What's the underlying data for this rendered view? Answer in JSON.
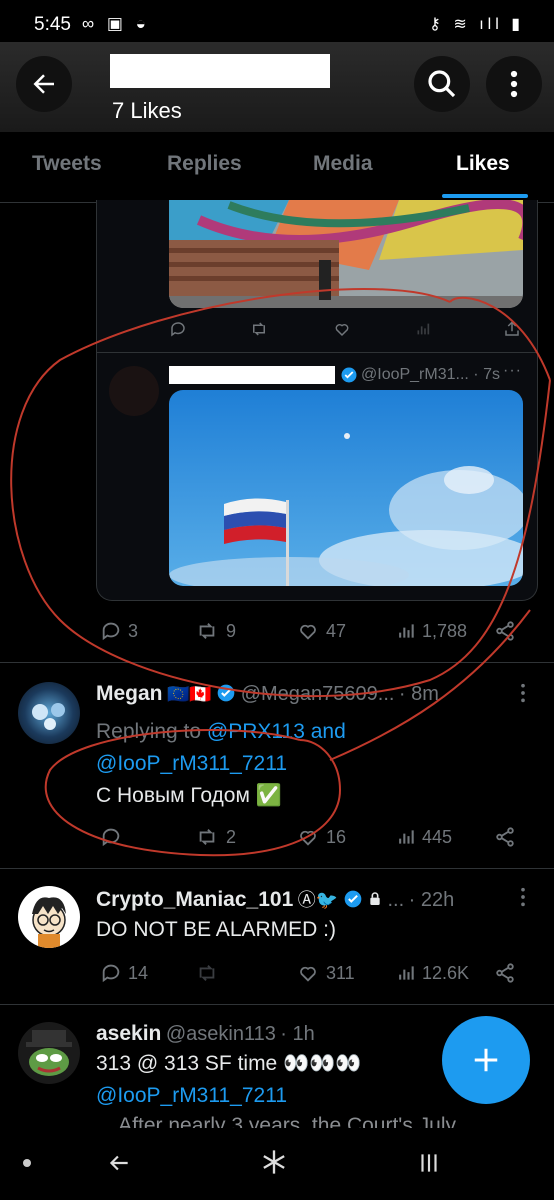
{
  "status_bar": {
    "time": "5:45",
    "left_icons": "∞ ▣ ◒",
    "right_icons": "⚷ ≋ ıll ▮"
  },
  "header": {
    "subtitle": "7 Likes"
  },
  "tabs": [
    {
      "label": "Tweets",
      "active": false
    },
    {
      "label": "Replies",
      "active": false
    },
    {
      "label": "Media",
      "active": false
    },
    {
      "label": "Likes",
      "active": true
    }
  ],
  "inner_tweet": {
    "handle_time": "@IooP_rM31... · 7s",
    "more": "···"
  },
  "tweet1_stats": {
    "replies": "3",
    "retweets": "9",
    "likes": "47",
    "views": "1,788"
  },
  "tweet2": {
    "name": "Megan",
    "flags": "🇪🇺🇨🇦",
    "handle": "@Megan75609...",
    "time": "· 8m",
    "replying_prefix": "Replying to ",
    "replying_to1": "@PRX113 and",
    "replying_to2": "@IooP_rM311_7211",
    "text": "С Новым Годом ✅",
    "stats": {
      "replies": "",
      "retweets": "2",
      "likes": "16",
      "views": "445"
    }
  },
  "tweet3": {
    "name": "Crypto_Maniac_101",
    "badges": "Ⓐ🐦",
    "handle": "...",
    "time": "· 22h",
    "text": "DO NOT BE ALARMED :)",
    "stats": {
      "replies": "14",
      "retweets": "",
      "likes": "311",
      "views": "12.6K"
    }
  },
  "tweet4": {
    "name": "asekin",
    "handle": "@asekin113",
    "time": "· 1h",
    "text_line1": "313 @ 313 SF time 👀👀👀",
    "mention": "@IooP_rM311_7211",
    "text_line3": "... After nearly 3 years, the Court's July"
  },
  "colors": {
    "accent": "#1d9bf0",
    "background": "#000000",
    "muted": "#71767b",
    "annotation": "#c0392b"
  }
}
